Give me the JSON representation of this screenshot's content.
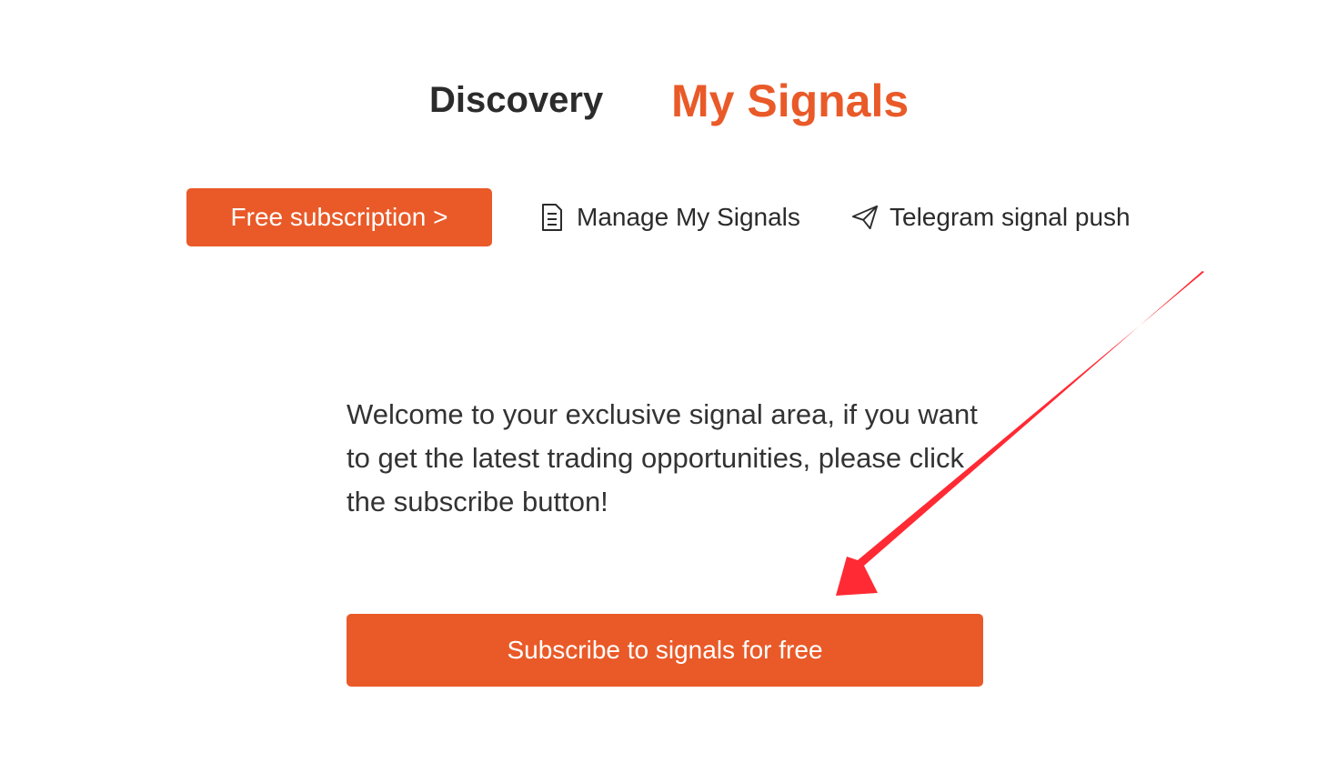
{
  "tabs": {
    "discovery": "Discovery",
    "my_signals": "My Signals"
  },
  "toolbar": {
    "free_subscription": "Free subscription >",
    "manage_my_signals": "Manage My Signals",
    "telegram_signal_push": "Telegram signal push"
  },
  "icons": {
    "manage": "document-icon",
    "telegram": "paper-plane-icon",
    "annotation": "red-arrow-icon"
  },
  "main": {
    "welcome_text": "Welcome to your exclusive signal area, if you want to get the latest trading opportunities, please click the subscribe button!",
    "subscribe_button": "Subscribe to signals for free"
  },
  "colors": {
    "accent": "#e95a28",
    "active_tab": "#e95a28",
    "text": "#333333",
    "annotation_arrow": "#ff2a33"
  }
}
